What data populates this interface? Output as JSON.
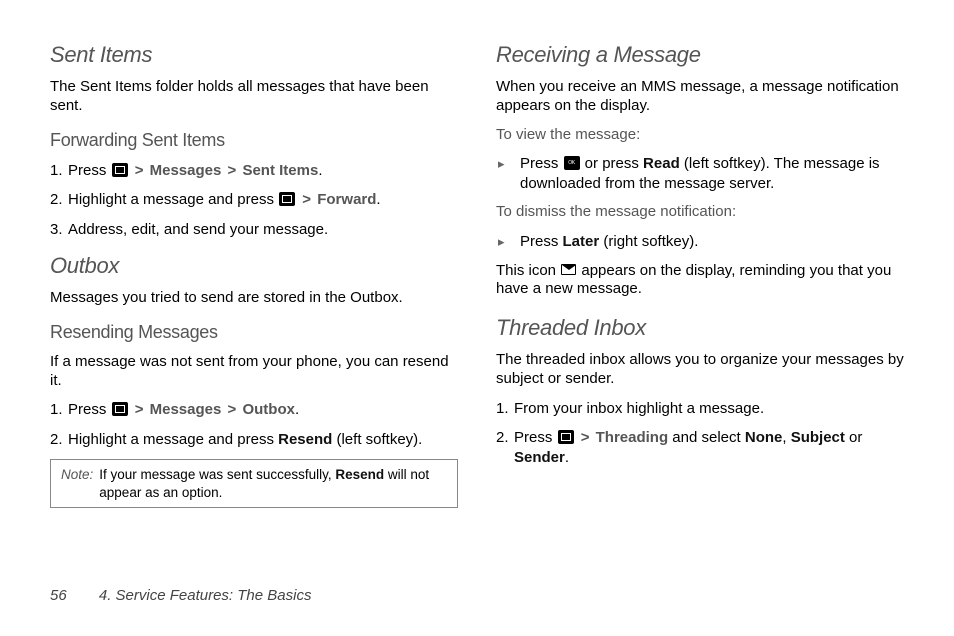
{
  "left": {
    "sent_items": {
      "heading": "Sent Items",
      "intro": "The Sent Items folder holds all messages that have been sent.",
      "forwarding": {
        "heading": "Forwarding Sent Items",
        "step1_a": "Press ",
        "step1_b": "Messages",
        "step1_c": "Sent Items",
        "step2_a": "Highlight a message and press ",
        "step2_b": "Forward",
        "step3": "Address, edit, and send your message."
      }
    },
    "outbox": {
      "heading": "Outbox",
      "intro": "Messages you tried to send are stored in the Outbox.",
      "resending": {
        "heading": "Resending Messages",
        "intro": "If a message was not sent from your phone, you can resend it.",
        "step1_a": "Press ",
        "step1_b": "Messages",
        "step1_c": "Outbox",
        "step2_a": "Highlight a message and press ",
        "step2_b": "Resend",
        "step2_c": " (left softkey).",
        "note_label": "Note:",
        "note_a": "If your message was sent successfully, ",
        "note_b": "Resend",
        "note_c": " will not appear as an option."
      }
    }
  },
  "right": {
    "receiving": {
      "heading": "Receiving a Message",
      "intro": "When you receive an MMS message, a message notification appears on the display.",
      "view_lead": "To view the message:",
      "view_a": "Press ",
      "view_b": " or press ",
      "view_c": "Read",
      "view_d": " (left softkey). The message is downloaded from the message server.",
      "dismiss_lead": "To dismiss the message notification:",
      "dismiss_a": "Press ",
      "dismiss_b": "Later",
      "dismiss_c": " (right softkey).",
      "icon_a": "This icon ",
      "icon_b": " appears on the display, reminding you that you have a new message."
    },
    "threaded": {
      "heading": "Threaded Inbox",
      "intro": "The threaded inbox allows you to organize your messages by subject or sender.",
      "step1": "From your inbox highlight a message.",
      "step2_a": "Press ",
      "step2_b": "Threading",
      "step2_c": " and select ",
      "step2_d": "None",
      "step2_e": "Subject",
      "step2_f": " or ",
      "step2_g": "Sender"
    }
  },
  "footer": {
    "page": "56",
    "chapter": "4. Service Features: The Basics"
  },
  "sep": ">",
  "comma": ", ",
  "period": "."
}
